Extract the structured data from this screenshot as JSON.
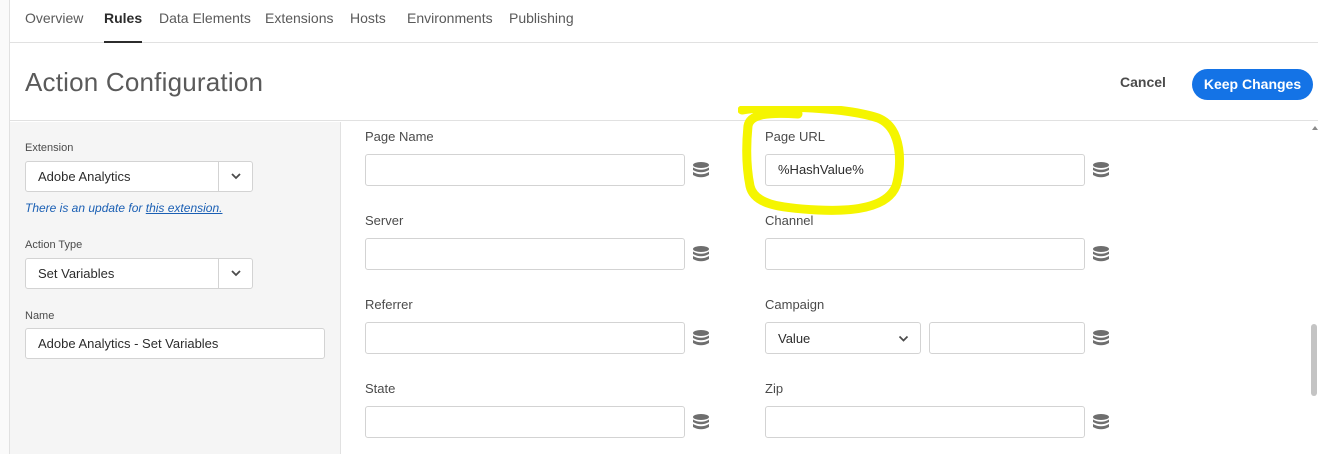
{
  "nav": {
    "tabs": [
      {
        "label": "Overview"
      },
      {
        "label": "Rules"
      },
      {
        "label": "Data Elements"
      },
      {
        "label": "Extensions"
      },
      {
        "label": "Hosts"
      },
      {
        "label": "Environments"
      },
      {
        "label": "Publishing"
      }
    ],
    "active": "Rules"
  },
  "header": {
    "title": "Action Configuration",
    "cancel_label": "Cancel",
    "keep_label": "Keep Changes"
  },
  "sidebar": {
    "extension_label": "Extension",
    "extension_value": "Adobe Analytics",
    "update_note_prefix": "There is an update for ",
    "update_note_link": "this extension.",
    "action_type_label": "Action Type",
    "action_type_value": "Set Variables",
    "name_label": "Name",
    "name_value": "Adobe Analytics - Set Variables"
  },
  "form": {
    "page_name": {
      "label": "Page Name",
      "value": ""
    },
    "page_url": {
      "label": "Page URL",
      "value": "%HashValue%"
    },
    "server": {
      "label": "Server",
      "value": ""
    },
    "channel": {
      "label": "Channel",
      "value": ""
    },
    "referrer": {
      "label": "Referrer",
      "value": ""
    },
    "campaign": {
      "label": "Campaign",
      "type_value": "Value",
      "value": ""
    },
    "state": {
      "label": "State",
      "value": ""
    },
    "zip": {
      "label": "Zip",
      "value": ""
    }
  },
  "colors": {
    "accent": "#1473e6",
    "highlight": "#f5f500"
  }
}
